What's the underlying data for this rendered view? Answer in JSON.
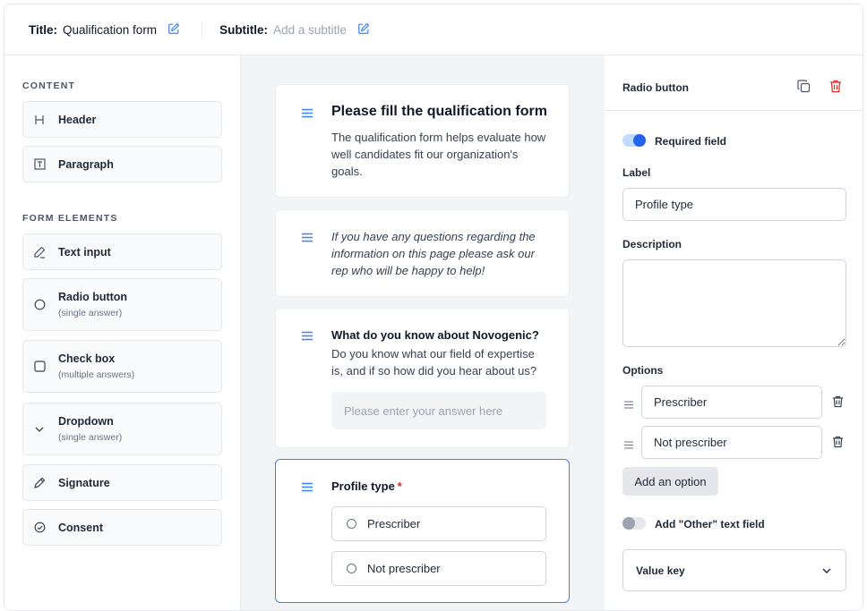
{
  "header": {
    "title_key": "Title:",
    "title_value": "Qualification form",
    "subtitle_key": "Subtitle:",
    "subtitle_placeholder": "Add a subtitle"
  },
  "sidebar": {
    "content_heading": "CONTENT",
    "form_heading": "FORM ELEMENTS",
    "content_items": [
      {
        "label": "Header",
        "icon": "heading-icon"
      },
      {
        "label": "Paragraph",
        "icon": "paragraph-icon"
      }
    ],
    "form_items": [
      {
        "label": "Text input",
        "sub": "",
        "icon": "pencil-icon"
      },
      {
        "label": "Radio button",
        "sub": "(single answer)",
        "icon": "radio-icon"
      },
      {
        "label": "Check box",
        "sub": "(multiple answers)",
        "icon": "checkbox-icon"
      },
      {
        "label": "Dropdown",
        "sub": "(single answer)",
        "icon": "chevron-down-icon"
      },
      {
        "label": "Signature",
        "sub": "",
        "icon": "signature-pen-icon"
      },
      {
        "label": "Consent",
        "sub": "",
        "icon": "check-circle-icon"
      }
    ]
  },
  "canvas": {
    "header_card": {
      "title": "Please fill the qualification form",
      "body": "The qualification form helps evaluate how well candidates fit our organization's goals."
    },
    "paragraph_card": {
      "body": "If you have any questions regarding the information on this page please ask our rep who will be happy to help!"
    },
    "question_card": {
      "title": "What do you know about Novogenic?",
      "body": "Do you know what our field of expertise is, and if so how did you hear about us?",
      "placeholder": "Please enter your answer here"
    },
    "radio_card": {
      "title": "Profile type",
      "required_mark": "*",
      "options": [
        "Prescriber",
        "Not prescriber"
      ]
    }
  },
  "panel": {
    "title": "Radio button",
    "required_label": "Required field",
    "required_on": true,
    "label_heading": "Label",
    "label_value": "Profile type",
    "description_heading": "Description",
    "description_value": "",
    "options_heading": "Options",
    "options": [
      "Prescriber",
      "Not prescriber"
    ],
    "add_option_label": "Add an option",
    "other_label": "Add \"Other\" text field",
    "other_on": false,
    "value_key_label": "Value key"
  },
  "colors": {
    "accent": "#2563eb",
    "delete": "#dc2626",
    "canvas_bg": "#f3f4f6",
    "border": "#e5e7eb"
  }
}
